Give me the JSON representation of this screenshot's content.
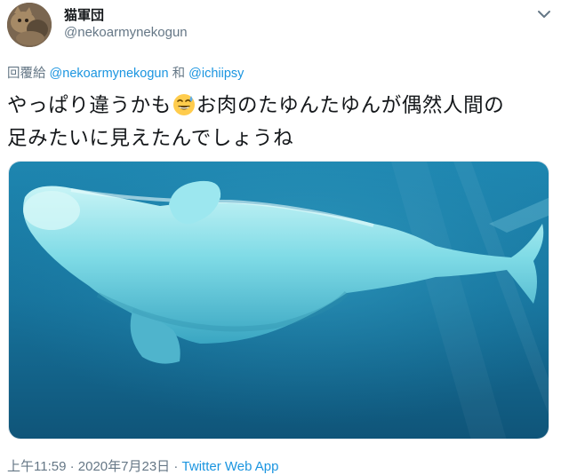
{
  "author": {
    "display_name": "猫軍団",
    "handle": "@nekoarmynekogun"
  },
  "reply": {
    "prefix": "回覆給",
    "user1": "@nekoarmynekogun",
    "joiner": "和",
    "user2": "@ichiipsy"
  },
  "tweet": {
    "line1_part1": "やっぱり違うかも",
    "emoji": "grinning-face-with-sweat-icon",
    "line1_part2": "お肉のたゆんたゆんが偶然人間の",
    "line2": "足みたいに見えたんでしょうね"
  },
  "footer": {
    "time": "上午11:59",
    "sep": "·",
    "date": "2020年7月23日",
    "source": "Twitter Web App"
  },
  "colors": {
    "link": "#1b95e0",
    "secondary_text": "#657786",
    "primary_text": "#14171a",
    "water": "#1b7aa3"
  }
}
